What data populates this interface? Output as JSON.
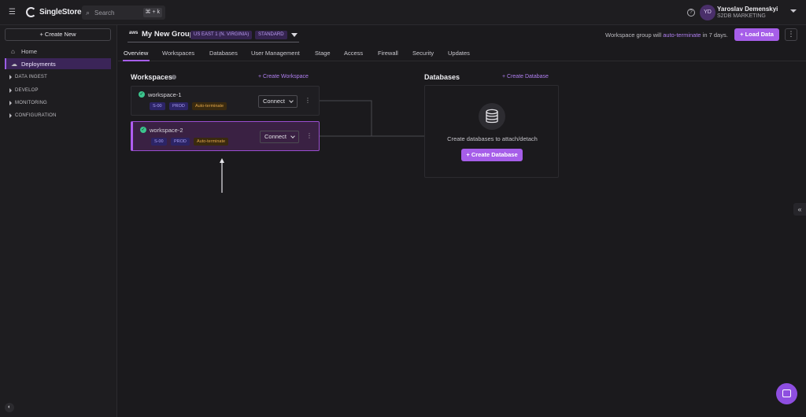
{
  "topbar": {
    "brand": "SingleStore.",
    "search_placeholder": "Search",
    "search_shortcut": "⌘ + k",
    "user_initials": "YD",
    "user_name": "Yaroslav Demenskyi",
    "user_org": "S2DB MARKETING"
  },
  "sidebar": {
    "create_new": "+ Create New",
    "items": [
      {
        "label": "Home",
        "icon": "home-icon"
      },
      {
        "label": "Deployments",
        "icon": "cloud-icon",
        "active": true
      }
    ],
    "sections": [
      "DATA INGEST",
      "DEVELOP",
      "MONITORING",
      "CONFIGURATION"
    ]
  },
  "group": {
    "provider": "aws",
    "name": "My New Group",
    "region": "US EAST 1 (N. VIRGINIA)",
    "tier": "STANDARD",
    "notice_prefix": "Workspace group will ",
    "notice_link": "auto-terminate",
    "notice_suffix": " in 7 days.",
    "load_data": "+ Load Data"
  },
  "tabs": [
    "Overview",
    "Workspaces",
    "Databases",
    "User Management",
    "Stage",
    "Access",
    "Firewall",
    "Security",
    "Updates"
  ],
  "workspaces": {
    "title": "Workspaces",
    "create_link": "+ Create Workspace",
    "items": [
      {
        "name": "workspace-1",
        "size": "S-00",
        "env": "PROD",
        "auto": "Auto-terminate",
        "connect": "Connect",
        "selected": false
      },
      {
        "name": "workspace-2",
        "size": "S-00",
        "env": "PROD",
        "auto": "Auto-terminate",
        "connect": "Connect",
        "selected": true
      }
    ]
  },
  "databases": {
    "title": "Databases",
    "create_link": "+ Create Database",
    "empty_text": "Create databases to attach/detach",
    "create_button": "+ Create Database"
  },
  "colors": {
    "accent": "#a65ee9",
    "background": "#1b1a1d",
    "success": "#3cc58e"
  }
}
